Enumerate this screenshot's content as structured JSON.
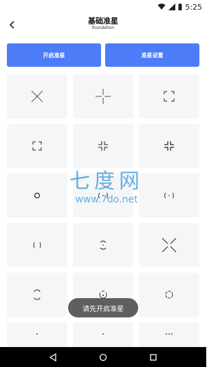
{
  "status_bar": {
    "time": "5:25"
  },
  "header": {
    "title": "基础准星",
    "subtitle": "foundation"
  },
  "buttons": {
    "open_label": "开启准星",
    "settings_label": "准星设置"
  },
  "watermark": {
    "big": "七度网",
    "small": "www.7do.net"
  },
  "toast": {
    "text": "请先开启准星"
  },
  "crosshairs": [
    "x-cross",
    "plus-gap",
    "corner-brackets",
    "corner-brackets-wide",
    "inward-corners",
    "inward-corners-tight",
    "circle",
    "paren-dot",
    "paren-small",
    "arcs-center",
    "x-gap",
    "rounded-brackets",
    "dot-circle",
    "circle-notched",
    "partial-circle",
    "small-dot",
    "small-dot",
    "triangle-dots"
  ]
}
